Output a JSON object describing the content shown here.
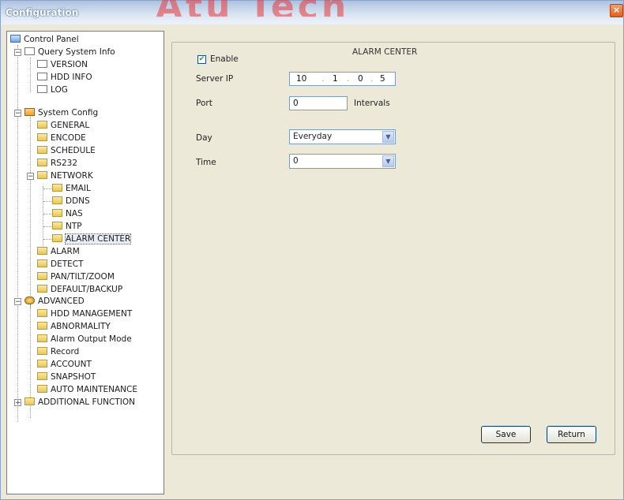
{
  "window": {
    "title": "Configuration",
    "watermark": "Atu Tech",
    "close_glyph": "×"
  },
  "tree": {
    "root": "Control Panel",
    "query_system_info": {
      "label": "Query System Info",
      "children": [
        "VERSION",
        "HDD INFO",
        "LOG"
      ]
    },
    "system_config": {
      "label": "System Config",
      "children": [
        "GENERAL",
        "ENCODE",
        "SCHEDULE",
        "RS232"
      ],
      "network": {
        "label": "NETWORK",
        "children": [
          "EMAIL",
          "DDNS",
          "NAS",
          "NTP",
          "ALARM CENTER"
        ]
      },
      "after": [
        "ALARM",
        "DETECT",
        "PAN/TILT/ZOOM",
        "DEFAULT/BACKUP"
      ]
    },
    "advanced": {
      "label": "ADVANCED",
      "children": [
        "HDD MANAGEMENT",
        "ABNORMALITY",
        "Alarm Output Mode",
        "Record",
        "ACCOUNT",
        "SNAPSHOT",
        "AUTO MAINTENANCE"
      ]
    },
    "additional": "ADDITIONAL FUNCTION"
  },
  "form": {
    "legend": "ALARM CENTER",
    "enable_label": "Enable",
    "enable_checked": true,
    "server_ip_label": "Server IP",
    "server_ip": [
      "10",
      "1",
      "0",
      "5"
    ],
    "port_label": "Port",
    "port_value": "0",
    "port_unit": "Intervals",
    "day_label": "Day",
    "day_value": "Everyday",
    "time_label": "Time",
    "time_value": "0",
    "dropdown_glyph": "▼",
    "check_glyph": "✔"
  },
  "buttons": {
    "save": "Save",
    "return": "Return"
  }
}
